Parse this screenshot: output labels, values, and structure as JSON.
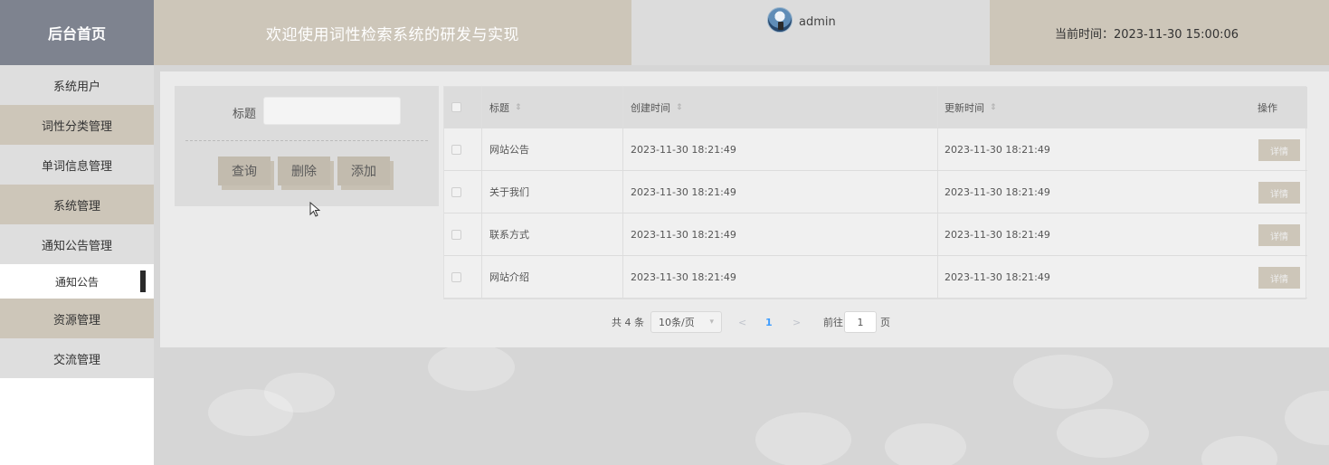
{
  "header": {
    "brand": "后台首页",
    "title": "欢迎使用词性检索系统的研发与实现",
    "username": "admin",
    "time_label": "当前时间：2023-11-30 15:00:06"
  },
  "sidebar": {
    "items": [
      {
        "label": "系统用户"
      },
      {
        "label": "词性分类管理"
      },
      {
        "label": "单词信息管理"
      },
      {
        "label": "系统管理"
      },
      {
        "label": "通知公告管理"
      },
      {
        "label": "通知公告"
      },
      {
        "label": "资源管理"
      },
      {
        "label": "交流管理"
      }
    ]
  },
  "search": {
    "label": "标题",
    "value": "",
    "buttons": {
      "query": "查询",
      "delete": "删除",
      "add": "添加"
    }
  },
  "table": {
    "headers": {
      "title": "标题",
      "created": "创建时间",
      "updated": "更新时间",
      "actions": "操作"
    },
    "sort_icon": "⇕",
    "rows": [
      {
        "title": "网站公告",
        "created": "2023-11-30 18:21:49",
        "updated": "2023-11-30 18:21:49",
        "action": "详情"
      },
      {
        "title": "关于我们",
        "created": "2023-11-30 18:21:49",
        "updated": "2023-11-30 18:21:49",
        "action": "详情"
      },
      {
        "title": "联系方式",
        "created": "2023-11-30 18:21:49",
        "updated": "2023-11-30 18:21:49",
        "action": "详情"
      },
      {
        "title": "网站介绍",
        "created": "2023-11-30 18:21:49",
        "updated": "2023-11-30 18:21:49",
        "action": "详情"
      }
    ]
  },
  "pagination": {
    "total": "共 4 条",
    "page_size": "10条/页",
    "prev": "<",
    "current": "1",
    "next": ">",
    "goto_label": "前往",
    "goto_value": "1",
    "page_unit": "页"
  },
  "colors": {
    "accent_tan": "#cdc6b9",
    "brand_gray": "#7e838f",
    "pager_active": "#409eff"
  }
}
